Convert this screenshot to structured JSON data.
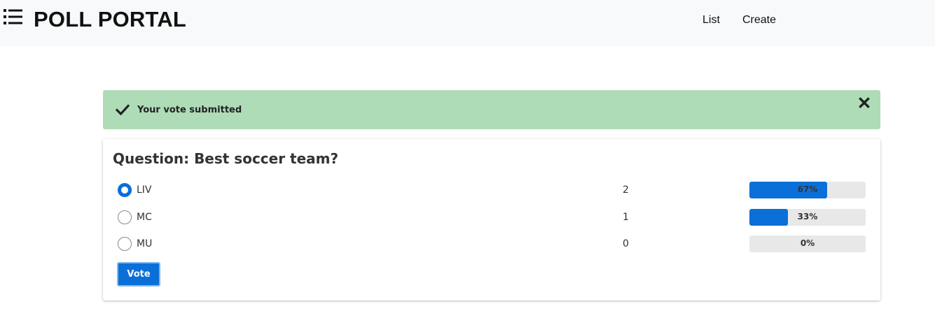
{
  "header": {
    "brand_icon": "list-icon",
    "title": "POLL PORTAL",
    "nav": [
      {
        "label": "List"
      },
      {
        "label": "Create"
      }
    ]
  },
  "alert": {
    "icon": "checkmark-icon",
    "message": "Your vote submitted",
    "close_icon": "close-icon",
    "color": "#aedcb7"
  },
  "poll": {
    "question": "Question: Best soccer team?",
    "options": [
      {
        "label": "LIV",
        "count": "2",
        "percent_text": "67%",
        "percent": 67,
        "selected": true
      },
      {
        "label": "MC",
        "count": "1",
        "percent_text": "33%",
        "percent": 33,
        "selected": false
      },
      {
        "label": "MU",
        "count": "0",
        "percent_text": "0%",
        "percent": 0,
        "selected": false
      }
    ],
    "vote_label": "Vote",
    "accent_color": "#0a6fd9"
  }
}
